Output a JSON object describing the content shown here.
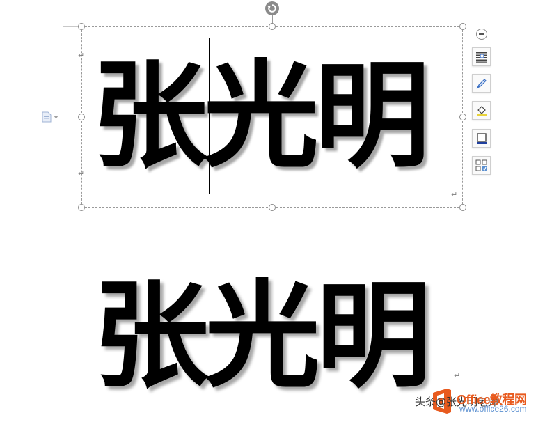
{
  "document": {
    "textbox_text": "张光明",
    "body_text": "张光明",
    "paragraph_mark": "↵"
  },
  "quick_tools": {
    "collapse": "minus-circle-icon",
    "items": [
      {
        "name": "layout-options",
        "icon": "text-wrap-icon"
      },
      {
        "name": "shape-style",
        "icon": "pen-icon"
      },
      {
        "name": "shape-fill",
        "icon": "fill-bucket-icon"
      },
      {
        "name": "shape-outline",
        "icon": "outline-square-icon"
      },
      {
        "name": "more-options",
        "icon": "shapes-grid-icon"
      }
    ]
  },
  "watermark": {
    "caption": "头条@张光明老师",
    "logo_text": "Office教程网",
    "logo_url": "www.office26.com"
  },
  "colors": {
    "selection_frame": "#9a9a9a",
    "logo_orange": "#e85a1e",
    "logo_blue": "#5a8fd0"
  }
}
